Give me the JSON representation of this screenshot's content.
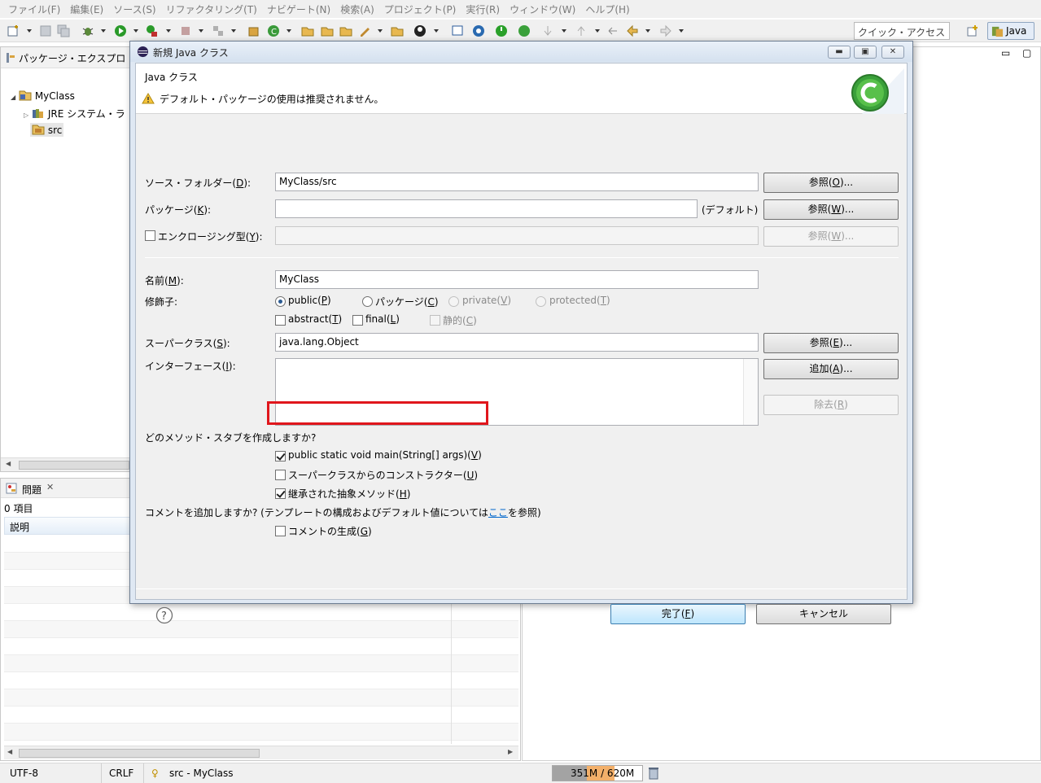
{
  "menu": [
    "ファイル(F)",
    "編集(E)",
    "ソース(S)",
    "リファクタリング(T)",
    "ナビゲート(N)",
    "検索(A)",
    "プロジェクト(P)",
    "実行(R)",
    "ウィンドウ(W)",
    "ヘルプ(H)"
  ],
  "toolbar": {
    "quick_access": "クイック・アクセス",
    "perspective": "Java"
  },
  "package_explorer": {
    "title": "パッケージ・エクスプロ",
    "project": "MyClass",
    "jre": "JRE システム・ラ",
    "src": "src"
  },
  "problems": {
    "title": "問題",
    "count": "0 項目",
    "column": "説明"
  },
  "status": {
    "encoding": "UTF-8",
    "line_end": "CRLF",
    "selection": "src - MyClass",
    "memory": "351M / 620M"
  },
  "dialog": {
    "title": "新規 Java クラス",
    "header": "Java クラス",
    "warning": "デフォルト・パッケージの使用は推奨されません。",
    "source_folder_label": "ソース・フォルダー(D):",
    "source_folder_value": "MyClass/src",
    "browse_o": "参照(O)...",
    "package_label": "パッケージ(K):",
    "package_value": "",
    "package_default": "(デフォルト)",
    "browse_w": "参照(W)...",
    "enclosing_label": "エンクロージング型(Y):",
    "browse_w2": "参照(W)...",
    "name_label": "名前(M):",
    "name_value": "MyClass",
    "modifiers_label": "修飾子:",
    "mod_public": "public(P)",
    "mod_package": "パッケージ(C)",
    "mod_private": "private(V)",
    "mod_protected": "protected(T)",
    "mod_abstract": "abstract(T)",
    "mod_final": "final(L)",
    "mod_static": "静的(C)",
    "superclass_label": "スーパークラス(S):",
    "superclass_value": "java.lang.Object",
    "browse_e": "参照(E)...",
    "interfaces_label": "インターフェース(I):",
    "add": "追加(A)...",
    "remove": "除去(R)",
    "stubs_label": "どのメソッド・スタブを作成しますか?",
    "stub_main": "public static void main(String[] args)(V)",
    "stub_constructors": "スーパークラスからのコンストラクター(U)",
    "stub_inherited": "継承された抽象メソッド(H)",
    "comments_label_pre": "コメントを追加しますか? (テンプレートの構成およびデフォルト値については",
    "comments_link": "ここ",
    "comments_label_post": "を参照)",
    "comments_generate": "コメントの生成(G)",
    "finish": "完了(F)",
    "cancel": "キャンセル",
    "help": "?",
    "colors": {
      "highlight": "#e0161c",
      "link": "#0066cc"
    }
  }
}
